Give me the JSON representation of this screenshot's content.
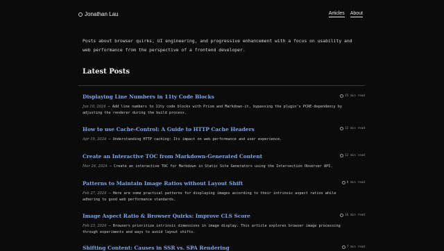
{
  "site": {
    "name": "Jonathan Lau",
    "nav": [
      {
        "label": "Articles"
      },
      {
        "label": "About"
      }
    ]
  },
  "intro": "Posts about browser quirks, UI engineering, and progressive enhancement with a focus on usability and web performance from the perspective of a frontend developer.",
  "section_title": "Latest Posts",
  "posts": [
    {
      "title": "Displaying Line Numbers in 11ty Code Blocks",
      "read_time": "15 min read",
      "date": "Jun 10, 2024",
      "separator": "—",
      "summary": "Add line numbers to 11ty code blocks with Prism and Markdown-it, bypassing the plugin's PCRE-dependency by adjusting the renderer during the build process."
    },
    {
      "title": "How to use Cache-Control: A Guide to HTTP Cache Headers",
      "read_time": "12 min read",
      "date": "Apr 19, 2024",
      "separator": "—",
      "summary": "Understanding HTTP caching: Its impact on web performance and user experience."
    },
    {
      "title": "Create an Interactive TOC from Markdown-Generated Content",
      "read_time": "12 min read",
      "date": "Mar 24, 2024",
      "separator": "—",
      "summary": "Create an interactive TOC for Markdown in Static Site Generators using the Intersection Observer API."
    },
    {
      "title": "Patterns to Maintain Image Ratios without Layout Shift",
      "read_time": "8 min read",
      "date": "Feb 27, 2024",
      "separator": "—",
      "summary": "Here are some practical patterns for displaying images according to their intrinsic aspect ratios while adhering to good web performance standards."
    },
    {
      "title": "Image Aspect Ratio & Browser Quirks: Improve CLS Score",
      "read_time": "16 min read",
      "date": "Feb 23, 2024",
      "separator": "—",
      "summary": "Browsers prioritize intrinsic dimensions in image display. This article explores browser image processing through experiments and ways to avoid layout shifts."
    },
    {
      "title": "Shifting Content: Causes in SSR vs. SPA Rendering",
      "read_time": "7 min read",
      "date": "",
      "separator": "",
      "summary": ""
    }
  ]
}
